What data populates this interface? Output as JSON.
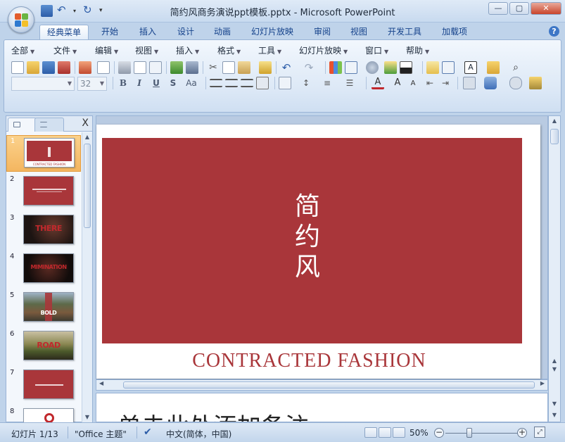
{
  "window": {
    "title": "简约风商务演说ppt模板.pptx - Microsoft PowerPoint",
    "minimize": "—",
    "maximize": "▢",
    "close": "✕"
  },
  "ribbon_tabs": [
    "经典菜单",
    "开始",
    "插入",
    "设计",
    "动画",
    "幻灯片放映",
    "审阅",
    "视图",
    "开发工具",
    "加载项"
  ],
  "help_button": "?",
  "classic_menu": [
    "全部",
    "文件",
    "编辑",
    "视图",
    "插入",
    "格式",
    "工具",
    "幻灯片放映",
    "窗口",
    "帮助"
  ],
  "format": {
    "font_name": "",
    "font_size": "32",
    "bold": "B",
    "italic": "I",
    "underline": "U",
    "shadow": "S",
    "change_case": "Aa"
  },
  "slide_panel": {
    "close": "X",
    "slides": [
      {
        "num": "1",
        "kind": "red",
        "caption": "CONTRACTED FASHION"
      },
      {
        "num": "2",
        "kind": "red-text"
      },
      {
        "num": "3",
        "kind": "photo-dark",
        "big": "THERE"
      },
      {
        "num": "4",
        "kind": "photo-dark",
        "big": "MIMINATION"
      },
      {
        "num": "5",
        "kind": "photo-crowd",
        "big": "BOLD"
      },
      {
        "num": "6",
        "kind": "photo-road",
        "big": "ROAD"
      },
      {
        "num": "7",
        "kind": "red-text"
      },
      {
        "num": "8",
        "kind": "white"
      }
    ]
  },
  "slide": {
    "title": "简约风",
    "subtitle": "CONTRACTED FASHION",
    "bg_color": "#a9363a"
  },
  "notes": {
    "text": "单击此处添加备注"
  },
  "status": {
    "slide_counter": "幻灯片 1/13",
    "theme": "\"Office 主题\"",
    "language": "中文(简体，中国)",
    "zoom": "50%",
    "zoom_level_fraction": 0.33
  }
}
